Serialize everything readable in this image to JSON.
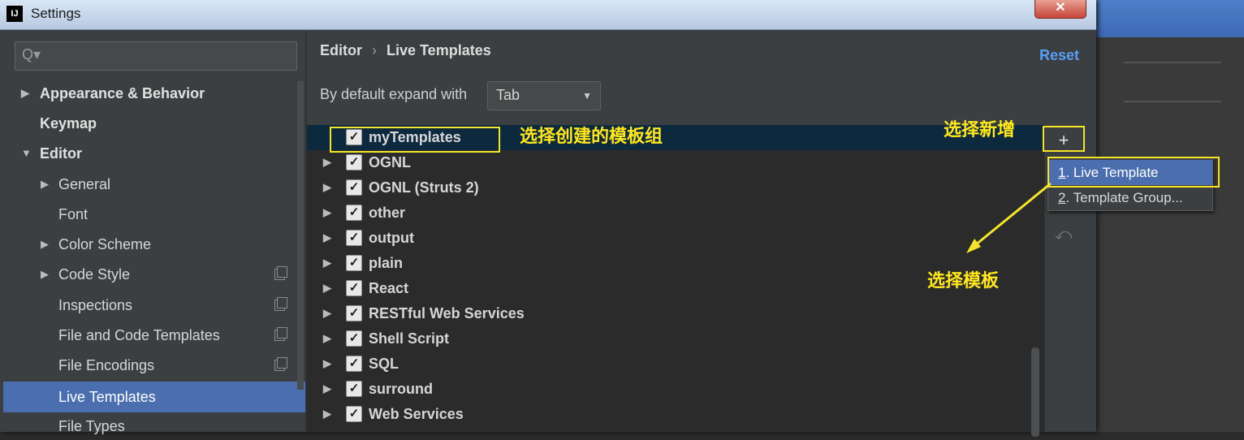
{
  "window": {
    "title": "Settings",
    "app_icon": "IJ",
    "close_label": "✕"
  },
  "search": {
    "placeholder": "Q▾"
  },
  "sidebar": {
    "items": [
      {
        "label": "Appearance & Behavior",
        "arrow": "▶"
      },
      {
        "label": "Keymap"
      },
      {
        "label": "Editor",
        "arrow": "▼"
      },
      {
        "label": "General",
        "arrow": "▶"
      },
      {
        "label": "Font"
      },
      {
        "label": "Color Scheme",
        "arrow": "▶"
      },
      {
        "label": "Code Style",
        "arrow": "▶"
      },
      {
        "label": "Inspections"
      },
      {
        "label": "File and Code Templates"
      },
      {
        "label": "File Encodings"
      },
      {
        "label": "Live Templates"
      },
      {
        "label": "File Types"
      }
    ]
  },
  "breadcrumb": {
    "part1": "Editor",
    "separator": "›",
    "part2": "Live Templates"
  },
  "reset_label": "Reset",
  "expand": {
    "label": "By default expand with",
    "value": "Tab",
    "caret": "▼"
  },
  "templates": [
    {
      "label": "myTemplates",
      "checked": true
    },
    {
      "label": "OGNL",
      "arrow": "▶",
      "checked": true
    },
    {
      "label": "OGNL (Struts 2)",
      "arrow": "▶",
      "checked": true
    },
    {
      "label": "other",
      "arrow": "▶",
      "checked": true
    },
    {
      "label": "output",
      "arrow": "▶",
      "checked": true
    },
    {
      "label": "plain",
      "arrow": "▶",
      "checked": true
    },
    {
      "label": "React",
      "arrow": "▶",
      "checked": true
    },
    {
      "label": "RESTful Web Services",
      "arrow": "▶",
      "checked": true
    },
    {
      "label": "Shell Script",
      "arrow": "▶",
      "checked": true
    },
    {
      "label": "SQL",
      "arrow": "▶",
      "checked": true
    },
    {
      "label": "surround",
      "arrow": "▶",
      "checked": true
    },
    {
      "label": "Web Services",
      "arrow": "▶",
      "checked": true
    }
  ],
  "checkmark": "✓",
  "toolbar": {
    "add": "+",
    "undo": "⤺"
  },
  "popup": {
    "items": [
      {
        "num": "1",
        "label": ". Live Template"
      },
      {
        "num": "2",
        "label": ". Template Group..."
      }
    ]
  },
  "annotations": {
    "select_group": "选择创建的模板组",
    "select_add": "选择新增",
    "select_template": "选择模板"
  },
  "colors": {
    "accent": "#4b6eaf",
    "annotation": "#f5e52a",
    "link": "#589df6"
  }
}
